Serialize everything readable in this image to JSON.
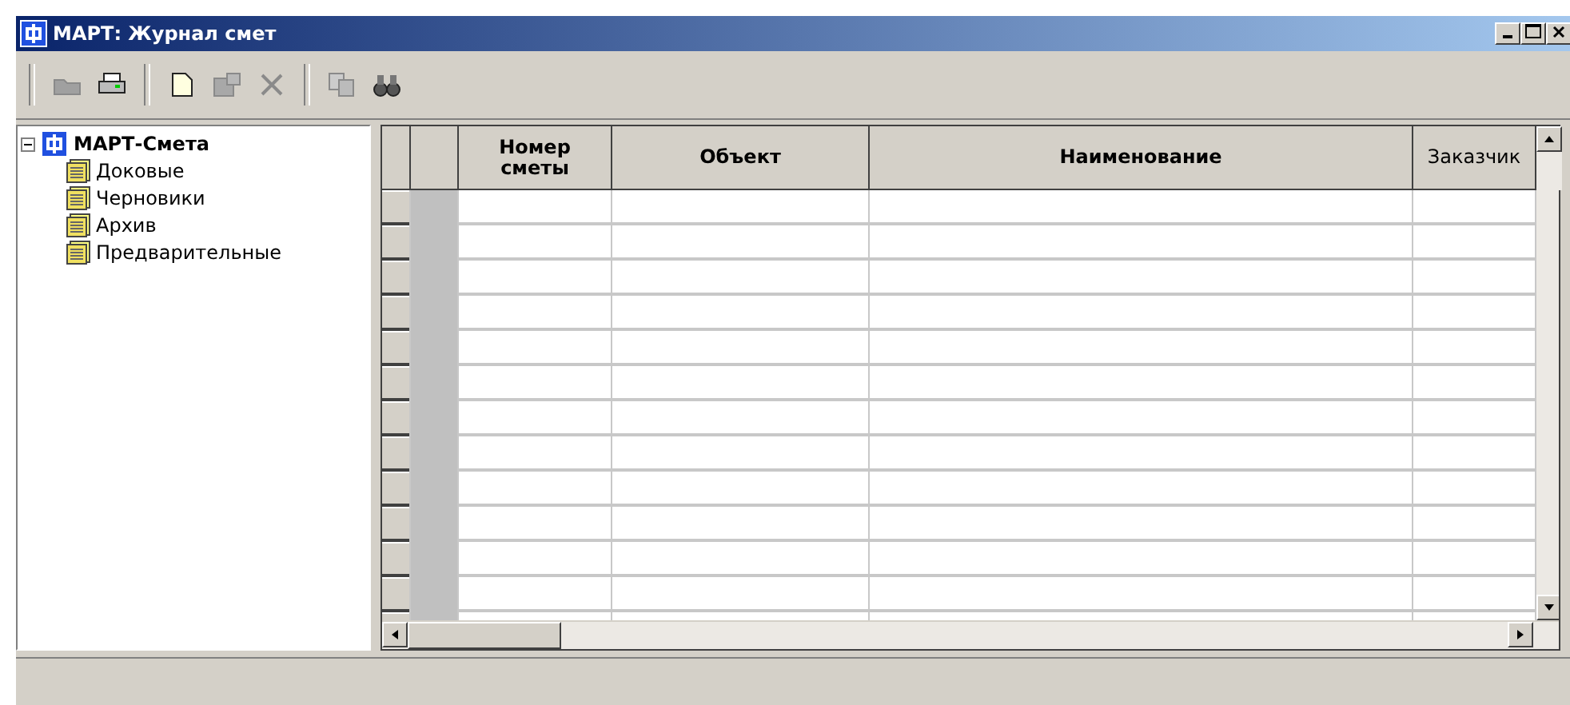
{
  "window": {
    "title": "МАРТ: Журнал смет"
  },
  "toolbar": [
    {
      "kind": "open",
      "disabled": true
    },
    {
      "kind": "print",
      "disabled": false
    },
    {
      "kind": "sep"
    },
    {
      "kind": "new",
      "disabled": false
    },
    {
      "kind": "props",
      "disabled": true
    },
    {
      "kind": "delete",
      "disabled": true
    },
    {
      "kind": "sep"
    },
    {
      "kind": "copy",
      "disabled": true
    },
    {
      "kind": "find",
      "disabled": false
    }
  ],
  "tree": {
    "label": "МАРТ-Смета",
    "expanded": true,
    "children": [
      {
        "label": "Доковые"
      },
      {
        "label": "Черновики"
      },
      {
        "label": "Архив"
      },
      {
        "label": "Предварительные"
      }
    ]
  },
  "table": {
    "columns": [
      {
        "label": "Номер сметы",
        "bold": true
      },
      {
        "label": "Объект",
        "bold": true
      },
      {
        "label": "Наименование",
        "bold": true
      },
      {
        "label": "Заказчик",
        "bold": false
      }
    ]
  }
}
